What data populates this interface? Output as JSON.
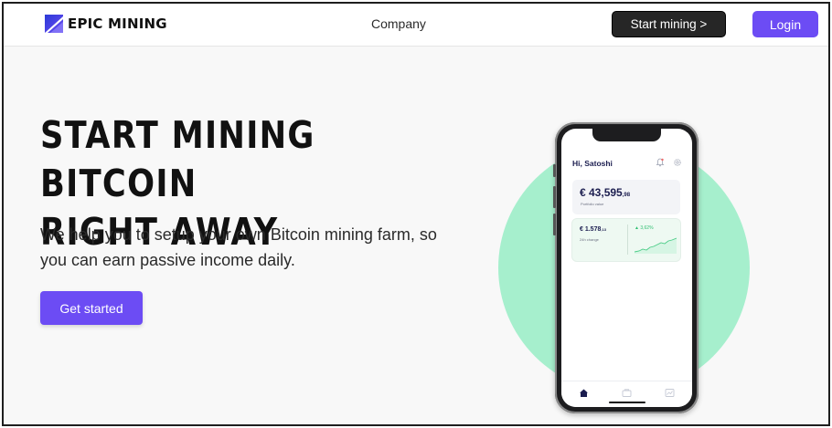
{
  "header": {
    "brand": "EPIC MINING",
    "nav_company": "Company",
    "start_mining_label": "Start mining >",
    "login_label": "Login"
  },
  "hero": {
    "title_line1": "START MINING BITCOIN",
    "title_line2": "RIGHT AWAY",
    "subtitle_line1": "We help you to setup your own Bitcoin mining farm, so",
    "subtitle_line2": "you can earn passive income daily.",
    "cta_label": "Get started"
  },
  "phone": {
    "greeting": "Hi, Satoshi",
    "portfolio_value": "€ 43,595",
    "portfolio_cents": ",98",
    "portfolio_label": "Portfolio value",
    "change_value": "€ 1.578",
    "change_cents": ",13",
    "change_label": "24h change",
    "change_pct": "▲ 3,62%"
  },
  "icons": {
    "logo": "epic-mining-logo-icon",
    "bell": "bell-icon",
    "settings": "gear-icon",
    "home": "home-icon",
    "wallet": "wallet-icon",
    "chart": "chart-icon"
  },
  "colors": {
    "accent": "#6c4cf4",
    "dark_button": "#262626",
    "circle": "#a6efcd",
    "positive": "#2fbf71",
    "navy": "#1b1d4f"
  }
}
